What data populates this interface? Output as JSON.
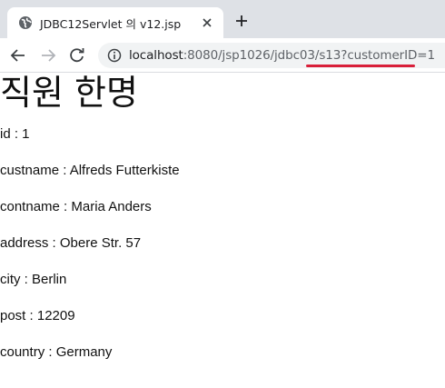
{
  "browser": {
    "tab": {
      "title": "JDBC12Servlet 의 v12.jsp"
    },
    "address": {
      "host": "localhost",
      "path": ":8080/jsp1026/jdbc03/s13?customerID=1"
    }
  },
  "page": {
    "title": "직원 한명",
    "fields": [
      "id : 1",
      "custname : Alfreds Futterkiste",
      "contname : Maria Anders",
      "address : Obere Str. 57",
      "city : Berlin",
      "post : 12209",
      "country : Germany"
    ]
  },
  "colors": {
    "annotation_underline": "#d9203a",
    "tabstrip": "#dee1e6"
  }
}
